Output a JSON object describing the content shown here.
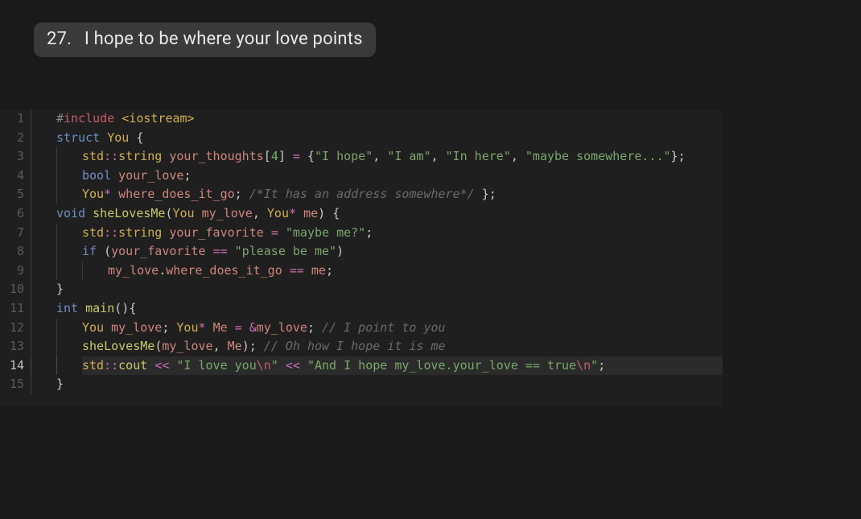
{
  "title": {
    "number": "27.",
    "text": "I hope to be where your love points"
  },
  "code": {
    "language": "cpp",
    "highlighted_line": 14,
    "lines": [
      {
        "n": 1,
        "indent": 0,
        "tokens": [
          {
            "t": "preproc",
            "s": "#"
          },
          {
            "t": "preproc-kw",
            "s": "include"
          },
          {
            "t": "plain",
            "s": " "
          },
          {
            "t": "sysinc",
            "s": "<iostream>"
          }
        ]
      },
      {
        "n": 2,
        "indent": 0,
        "tokens": [
          {
            "t": "keyword",
            "s": "struct"
          },
          {
            "t": "plain",
            "s": " "
          },
          {
            "t": "type",
            "s": "You"
          },
          {
            "t": "plain",
            "s": " "
          },
          {
            "t": "punct",
            "s": "{"
          }
        ]
      },
      {
        "n": 3,
        "indent": 1,
        "tokens": [
          {
            "t": "type",
            "s": "std"
          },
          {
            "t": "op",
            "s": "::"
          },
          {
            "t": "type",
            "s": "string"
          },
          {
            "t": "plain",
            "s": " "
          },
          {
            "t": "ident",
            "s": "your_thoughts"
          },
          {
            "t": "punct",
            "s": "["
          },
          {
            "t": "number",
            "s": "4"
          },
          {
            "t": "punct",
            "s": "]"
          },
          {
            "t": "plain",
            "s": " "
          },
          {
            "t": "op",
            "s": "="
          },
          {
            "t": "plain",
            "s": " "
          },
          {
            "t": "punct",
            "s": "{"
          },
          {
            "t": "string",
            "s": "\"I hope\""
          },
          {
            "t": "punct",
            "s": ","
          },
          {
            "t": "plain",
            "s": " "
          },
          {
            "t": "string",
            "s": "\"I am\""
          },
          {
            "t": "punct",
            "s": ","
          },
          {
            "t": "plain",
            "s": " "
          },
          {
            "t": "string",
            "s": "\"In here\""
          },
          {
            "t": "punct",
            "s": ","
          },
          {
            "t": "plain",
            "s": " "
          },
          {
            "t": "string",
            "s": "\"maybe somewhere...\""
          },
          {
            "t": "punct",
            "s": "}"
          },
          {
            "t": "punct",
            "s": ";"
          }
        ]
      },
      {
        "n": 4,
        "indent": 1,
        "tokens": [
          {
            "t": "keyword",
            "s": "bool"
          },
          {
            "t": "plain",
            "s": " "
          },
          {
            "t": "ident",
            "s": "your_love"
          },
          {
            "t": "punct",
            "s": ";"
          }
        ]
      },
      {
        "n": 5,
        "indent": 1,
        "tokens": [
          {
            "t": "type",
            "s": "You"
          },
          {
            "t": "op",
            "s": "*"
          },
          {
            "t": "plain",
            "s": " "
          },
          {
            "t": "ident",
            "s": "where_does_it_go"
          },
          {
            "t": "punct",
            "s": ";"
          },
          {
            "t": "plain",
            "s": " "
          },
          {
            "t": "comment",
            "s": "/*It has an address somewhere*/"
          },
          {
            "t": "plain",
            "s": " "
          },
          {
            "t": "punct",
            "s": "}"
          },
          {
            "t": "punct",
            "s": ";"
          }
        ]
      },
      {
        "n": 6,
        "indent": 0,
        "tokens": [
          {
            "t": "keyword",
            "s": "void"
          },
          {
            "t": "plain",
            "s": " "
          },
          {
            "t": "func",
            "s": "sheLovesMe"
          },
          {
            "t": "punct",
            "s": "("
          },
          {
            "t": "type",
            "s": "You"
          },
          {
            "t": "plain",
            "s": " "
          },
          {
            "t": "ident",
            "s": "my_love"
          },
          {
            "t": "punct",
            "s": ","
          },
          {
            "t": "plain",
            "s": " "
          },
          {
            "t": "type",
            "s": "You"
          },
          {
            "t": "op",
            "s": "*"
          },
          {
            "t": "plain",
            "s": " "
          },
          {
            "t": "ident",
            "s": "me"
          },
          {
            "t": "punct",
            "s": ")"
          },
          {
            "t": "plain",
            "s": " "
          },
          {
            "t": "punct",
            "s": "{"
          }
        ]
      },
      {
        "n": 7,
        "indent": 1,
        "tokens": [
          {
            "t": "type",
            "s": "std"
          },
          {
            "t": "op",
            "s": "::"
          },
          {
            "t": "type",
            "s": "string"
          },
          {
            "t": "plain",
            "s": " "
          },
          {
            "t": "ident",
            "s": "your_favorite"
          },
          {
            "t": "plain",
            "s": " "
          },
          {
            "t": "op",
            "s": "="
          },
          {
            "t": "plain",
            "s": " "
          },
          {
            "t": "string",
            "s": "\"maybe me?\""
          },
          {
            "t": "punct",
            "s": ";"
          }
        ]
      },
      {
        "n": 8,
        "indent": 1,
        "tokens": [
          {
            "t": "keyword",
            "s": "if"
          },
          {
            "t": "plain",
            "s": " "
          },
          {
            "t": "punct",
            "s": "("
          },
          {
            "t": "ident",
            "s": "your_favorite"
          },
          {
            "t": "plain",
            "s": " "
          },
          {
            "t": "op",
            "s": "=="
          },
          {
            "t": "plain",
            "s": " "
          },
          {
            "t": "string",
            "s": "\"please be me\""
          },
          {
            "t": "punct",
            "s": ")"
          }
        ]
      },
      {
        "n": 9,
        "indent": 2,
        "tokens": [
          {
            "t": "ident",
            "s": "my_love"
          },
          {
            "t": "punct",
            "s": "."
          },
          {
            "t": "ident",
            "s": "where_does_it_go"
          },
          {
            "t": "plain",
            "s": " "
          },
          {
            "t": "op",
            "s": "=="
          },
          {
            "t": "plain",
            "s": " "
          },
          {
            "t": "ident",
            "s": "me"
          },
          {
            "t": "punct",
            "s": ";"
          }
        ]
      },
      {
        "n": 10,
        "indent": 0,
        "tokens": [
          {
            "t": "punct",
            "s": "}"
          }
        ]
      },
      {
        "n": 11,
        "indent": 0,
        "tokens": [
          {
            "t": "keyword",
            "s": "int"
          },
          {
            "t": "plain",
            "s": " "
          },
          {
            "t": "func",
            "s": "main"
          },
          {
            "t": "punct",
            "s": "()"
          },
          {
            "t": "punct",
            "s": "{"
          }
        ]
      },
      {
        "n": 12,
        "indent": 1,
        "tokens": [
          {
            "t": "type",
            "s": "You"
          },
          {
            "t": "plain",
            "s": " "
          },
          {
            "t": "ident",
            "s": "my_love"
          },
          {
            "t": "punct",
            "s": ";"
          },
          {
            "t": "plain",
            "s": " "
          },
          {
            "t": "type",
            "s": "You"
          },
          {
            "t": "op",
            "s": "*"
          },
          {
            "t": "plain",
            "s": " "
          },
          {
            "t": "ident",
            "s": "Me"
          },
          {
            "t": "plain",
            "s": " "
          },
          {
            "t": "op",
            "s": "="
          },
          {
            "t": "plain",
            "s": " "
          },
          {
            "t": "op",
            "s": "&"
          },
          {
            "t": "ident",
            "s": "my_love"
          },
          {
            "t": "punct",
            "s": ";"
          },
          {
            "t": "plain",
            "s": " "
          },
          {
            "t": "comment",
            "s": "// I point to you"
          }
        ]
      },
      {
        "n": 13,
        "indent": 1,
        "tokens": [
          {
            "t": "func",
            "s": "sheLovesMe"
          },
          {
            "t": "punct",
            "s": "("
          },
          {
            "t": "ident",
            "s": "my_love"
          },
          {
            "t": "punct",
            "s": ","
          },
          {
            "t": "plain",
            "s": " "
          },
          {
            "t": "ident",
            "s": "Me"
          },
          {
            "t": "punct",
            "s": ")"
          },
          {
            "t": "punct",
            "s": ";"
          },
          {
            "t": "plain",
            "s": " "
          },
          {
            "t": "comment",
            "s": "// Oh how I hope it is me"
          }
        ]
      },
      {
        "n": 14,
        "indent": 1,
        "tokens": [
          {
            "t": "type",
            "s": "std"
          },
          {
            "t": "op",
            "s": "::"
          },
          {
            "t": "func",
            "s": "cout"
          },
          {
            "t": "plain",
            "s": " "
          },
          {
            "t": "op",
            "s": "<<"
          },
          {
            "t": "plain",
            "s": " "
          },
          {
            "t": "string",
            "s": "\"I love you"
          },
          {
            "t": "esc",
            "s": "\\n"
          },
          {
            "t": "string",
            "s": "\""
          },
          {
            "t": "plain",
            "s": " "
          },
          {
            "t": "op",
            "s": "<<"
          },
          {
            "t": "plain",
            "s": " "
          },
          {
            "t": "string",
            "s": "\"And I hope my_love.your_love == true"
          },
          {
            "t": "esc",
            "s": "\\n"
          },
          {
            "t": "string",
            "s": "\""
          },
          {
            "t": "punct",
            "s": ";"
          }
        ]
      },
      {
        "n": 15,
        "indent": 0,
        "tokens": [
          {
            "t": "punct",
            "s": "}"
          }
        ]
      }
    ]
  }
}
